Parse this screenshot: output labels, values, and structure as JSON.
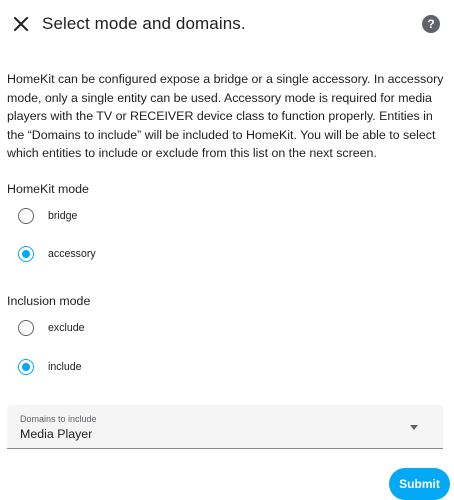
{
  "header": {
    "title": "Select mode and domains.",
    "close_icon": "close-icon",
    "help_icon": "help-circle-icon",
    "help_glyph": "?"
  },
  "description": "HomeKit can be configured expose a bridge or a single accessory. In accessory mode, only a single entity can be used. Accessory mode is required for media players with the TV or RECEIVER device class to function properly. Entities in the “Domains to include” will be included to HomeKit. You will be able to select which entities to include or exclude from this list on the next screen.",
  "homekit_mode": {
    "label": "HomeKit mode",
    "options": [
      {
        "label": "bridge",
        "checked": false
      },
      {
        "label": "accessory",
        "checked": true
      }
    ]
  },
  "inclusion_mode": {
    "label": "Inclusion mode",
    "options": [
      {
        "label": "exclude",
        "checked": false
      },
      {
        "label": "include",
        "checked": true
      }
    ]
  },
  "domains": {
    "label": "Domains to include",
    "value": "Media Player"
  },
  "submit_label": "Submit",
  "colors": {
    "accent": "#03a9f4",
    "text": "#212121",
    "icon": "#5f6368"
  }
}
